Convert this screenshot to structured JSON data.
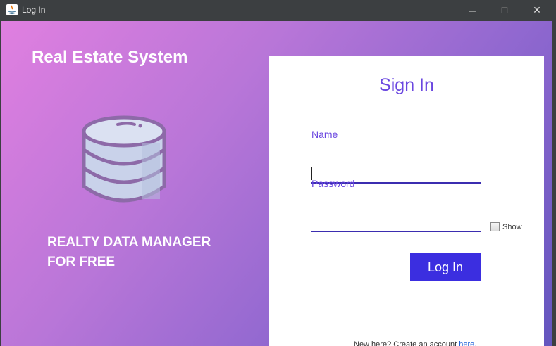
{
  "window": {
    "title": "Log In",
    "controls": {
      "minimize": "—",
      "maximize": "☐",
      "close": "✕"
    }
  },
  "brand": {
    "title": "Real Estate System",
    "tagline_line1": "REALTY DATA MANAGER",
    "tagline_line2": "FOR FREE",
    "illustration_icon": "database-icon"
  },
  "signin": {
    "title": "Sign In",
    "name_label": "Name",
    "name_value": "",
    "password_label": "Password",
    "password_value": "",
    "show_label": "Show",
    "show_checked": false,
    "login_label": "Log In",
    "footer_text": "New here? Create an account ",
    "footer_link": "here."
  },
  "colors": {
    "gradient_start": "#e07fe0",
    "gradient_end": "#6355be",
    "accent": "#6a47e0",
    "button": "#3b2ee0",
    "link": "#1a5ed8"
  }
}
